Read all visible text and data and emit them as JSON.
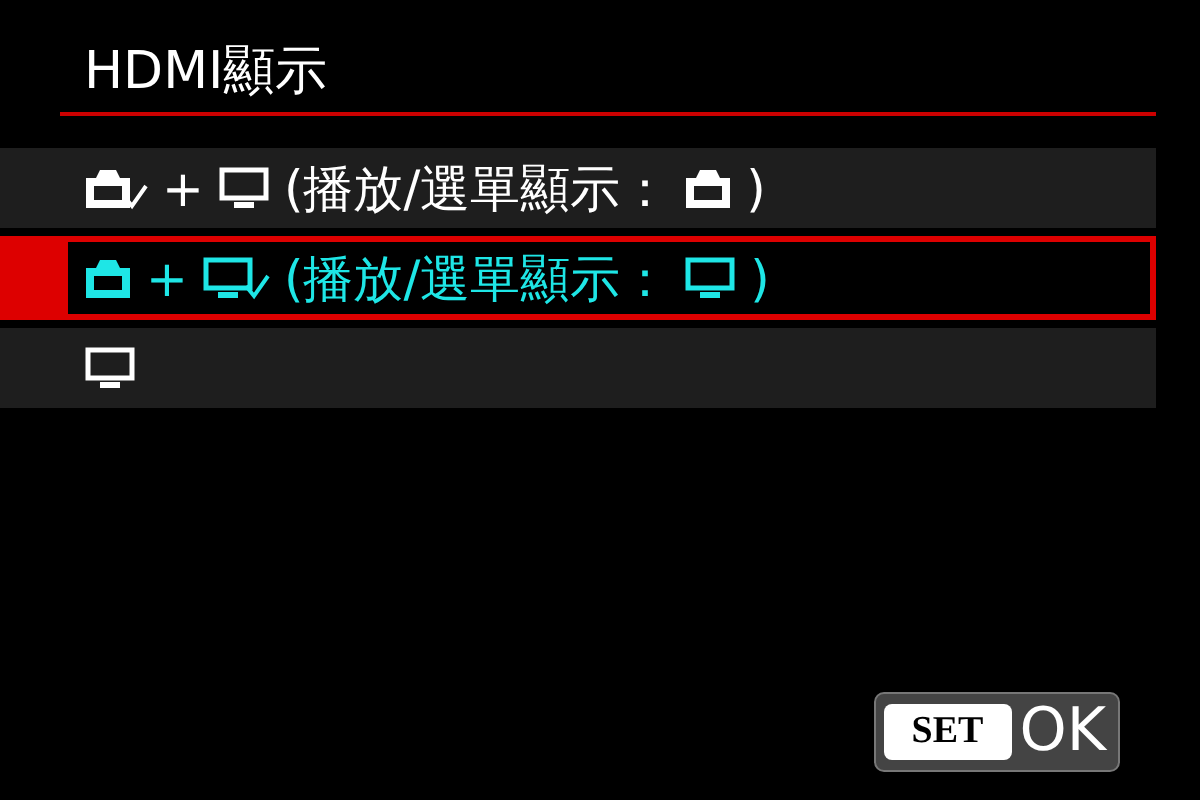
{
  "title": "HDMI顯示",
  "options": [
    {
      "selected": false,
      "parts": [
        {
          "kind": "camera",
          "checked": true
        },
        {
          "kind": "text",
          "text": "+"
        },
        {
          "kind": "monitor",
          "checked": false
        },
        {
          "kind": "text",
          "text": "(播放/選單顯示："
        },
        {
          "kind": "camera",
          "checked": false
        },
        {
          "kind": "text",
          "text": ")"
        }
      ]
    },
    {
      "selected": true,
      "parts": [
        {
          "kind": "camera",
          "checked": false
        },
        {
          "kind": "text",
          "text": "+"
        },
        {
          "kind": "monitor",
          "checked": true
        },
        {
          "kind": "text",
          "text": "(播放/選單顯示："
        },
        {
          "kind": "monitor",
          "checked": false
        },
        {
          "kind": "text",
          "text": ")"
        }
      ]
    },
    {
      "selected": false,
      "parts": [
        {
          "kind": "monitor",
          "checked": false
        }
      ]
    }
  ],
  "set_button": {
    "key": "SET",
    "label": "OK"
  }
}
